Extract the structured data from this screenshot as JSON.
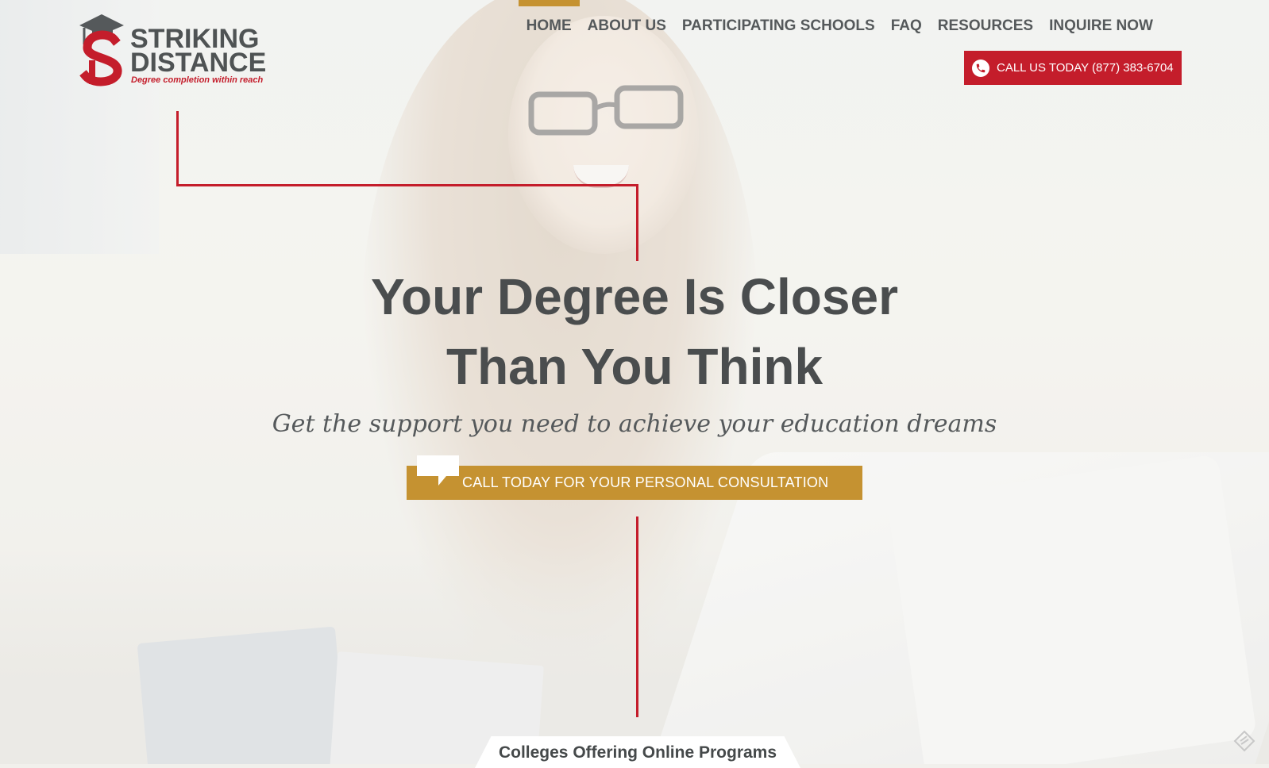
{
  "brand": {
    "name_line1": "STRIKING",
    "name_line2": "DISTANCE",
    "tagline": "Degree completion within reach",
    "logo_icon": "graduation-cap-s-icon",
    "colors": {
      "red": "#c41d2b",
      "gold": "#c59231",
      "gray": "#4f5354"
    }
  },
  "nav": {
    "items": [
      {
        "label": "HOME",
        "active": true
      },
      {
        "label": "ABOUT US",
        "active": false
      },
      {
        "label": "PARTICIPATING SCHOOLS",
        "active": false
      },
      {
        "label": "FAQ",
        "active": false
      },
      {
        "label": "RESOURCES",
        "active": false
      },
      {
        "label": "INQUIRE NOW",
        "active": false
      }
    ]
  },
  "call_button": {
    "label": "CALL US TODAY (877) 383-6704",
    "icon": "phone-icon"
  },
  "hero": {
    "headline_line1": "Your Degree Is Closer",
    "headline_line2": "Than You Think",
    "subhead": "Get the support you need to achieve your education dreams",
    "cta_label": "CALL TODAY FOR YOUR PERSONAL CONSULTATION",
    "cta_icon": "speech-bubble-icon"
  },
  "bottom_tab": {
    "label": "Colleges Offering Online Programs"
  },
  "corner_icon": "feedback-icon"
}
